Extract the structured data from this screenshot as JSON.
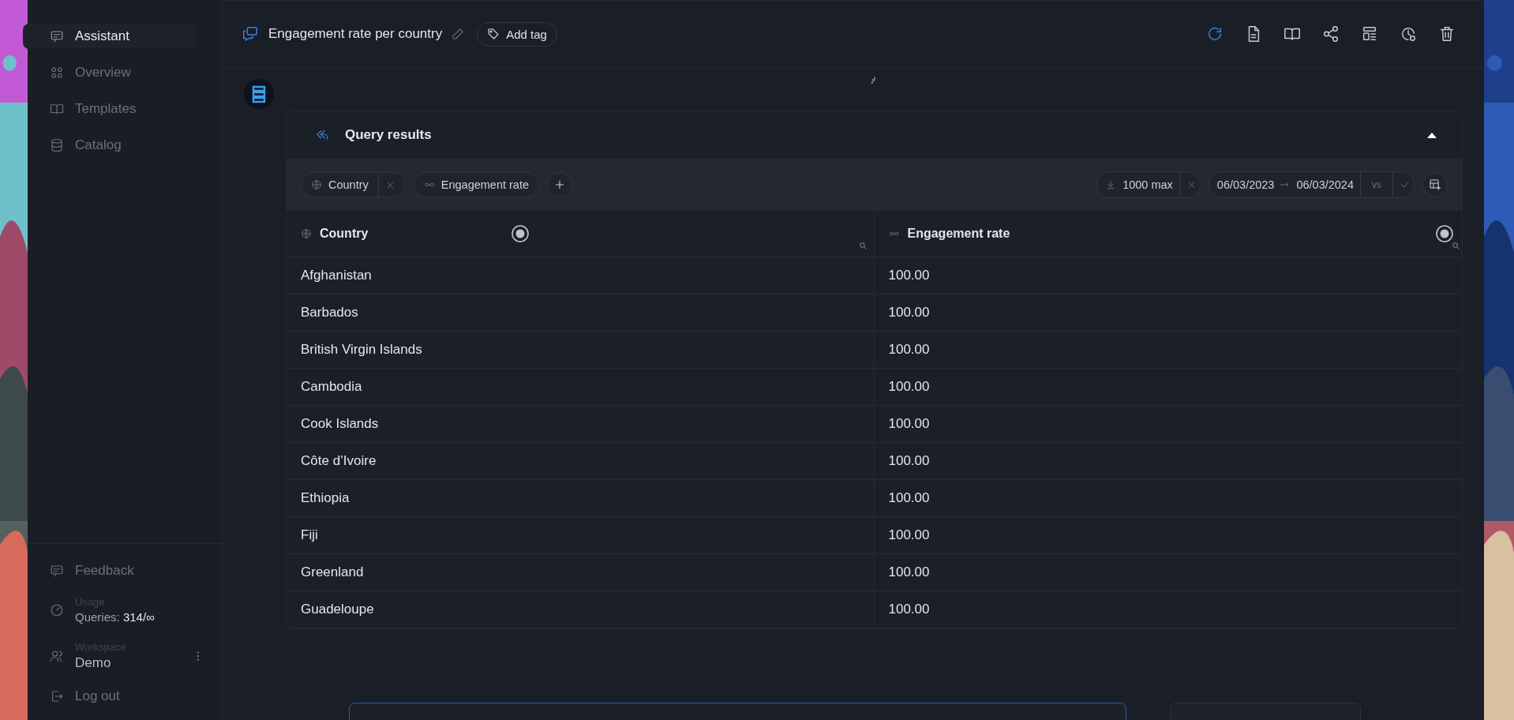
{
  "sidebar": {
    "items": [
      {
        "label": "Assistant",
        "selected": true
      },
      {
        "label": "Overview",
        "selected": false
      },
      {
        "label": "Templates",
        "selected": false
      },
      {
        "label": "Catalog",
        "selected": false
      }
    ],
    "feedback": "Feedback",
    "usage": {
      "label": "Usage",
      "queries_label": "Queries:",
      "queries_value": "314/∞"
    },
    "workspace": {
      "label": "Workspace",
      "name": "Demo"
    },
    "logout": "Log out"
  },
  "header": {
    "title": "Engagement rate per country",
    "add_tag": "Add tag"
  },
  "results": {
    "title": "Query results",
    "expanded": true,
    "chips": [
      {
        "label": "Country",
        "removable": true
      },
      {
        "label": "Engagement rate",
        "removable": false
      }
    ],
    "limit": "1000 max",
    "date_from": "06/03/2023",
    "date_to": "06/03/2024",
    "compare": "vs",
    "columns": [
      {
        "label": "Country"
      },
      {
        "label": "Engagement rate"
      }
    ],
    "rows": [
      [
        "Afghanistan",
        "100.00"
      ],
      [
        "Barbados",
        "100.00"
      ],
      [
        "British Virgin Islands",
        "100.00"
      ],
      [
        "Cambodia",
        "100.00"
      ],
      [
        "Cook Islands",
        "100.00"
      ],
      [
        "Côte d’Ivoire",
        "100.00"
      ],
      [
        "Ethiopia",
        "100.00"
      ],
      [
        "Fiji",
        "100.00"
      ],
      [
        "Greenland",
        "100.00"
      ],
      [
        "Guadeloupe",
        "100.00"
      ]
    ]
  }
}
